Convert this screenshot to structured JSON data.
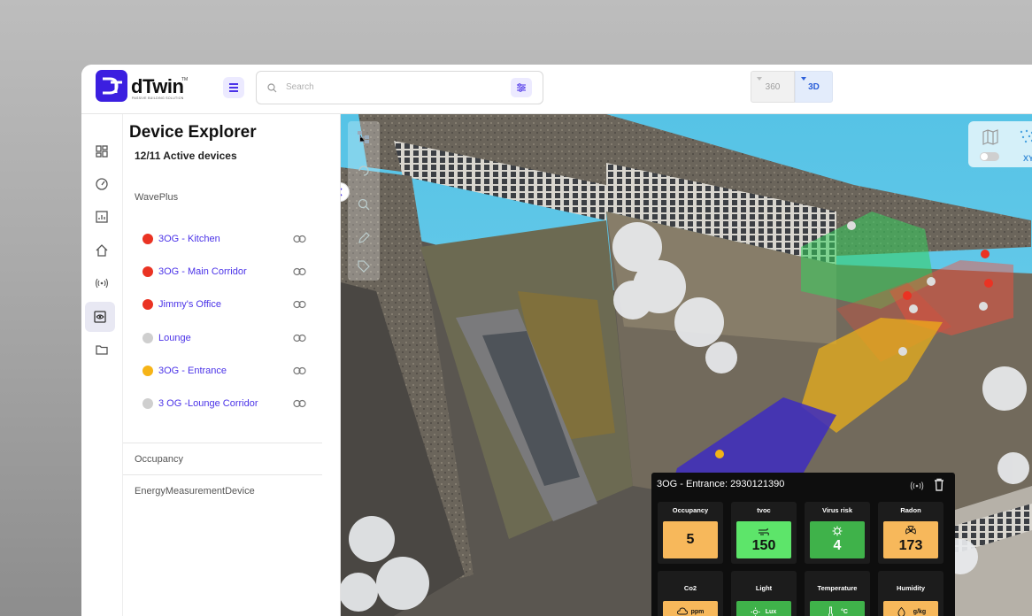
{
  "brand": {
    "name": "dTwin",
    "tagline": "PASSIVE BUILDING SOLUTION",
    "tm": "TM"
  },
  "search": {
    "placeholder": "Search"
  },
  "view_toggle": {
    "option_360": "360",
    "option_3d": "3D",
    "selected": "3D"
  },
  "explorer": {
    "title": "Device Explorer",
    "subtitle": "12/11 Active devices",
    "groups": [
      {
        "name": "WavePlus"
      },
      {
        "name": "Occupancy"
      },
      {
        "name": "EnergyMeasurementDevice"
      }
    ],
    "devices": [
      {
        "label": "3OG - Kitchen",
        "status_color": "#ea3323"
      },
      {
        "label": "3OG - Main Corridor",
        "status_color": "#ea3323"
      },
      {
        "label": "Jimmy's Office",
        "status_color": "#ea3323"
      },
      {
        "label": "Lounge",
        "status_color": "#cfcfcf"
      },
      {
        "label": "3OG - Entrance",
        "status_color": "#f6b417"
      },
      {
        "label": "3 OG -Lounge Corridor",
        "status_color": "#cfcfcf"
      }
    ]
  },
  "viewport": {
    "coord_label": "XY"
  },
  "popup": {
    "title": "3OG - Entrance: 2930121390",
    "tiles": [
      {
        "label": "Occupancy",
        "value": "5",
        "color": "#f7b85b",
        "icon": "none"
      },
      {
        "label": "tvoc",
        "value": "150",
        "color": "#5de56a",
        "icon": "wind-icon"
      },
      {
        "label": "Virus risk",
        "value": "4",
        "color": "#3fb24a",
        "icon": "virus-icon"
      },
      {
        "label": "Radon",
        "value": "173",
        "color": "#f7b85b",
        "icon": "radon-icon"
      }
    ],
    "tiles_row2": [
      {
        "label": "Co2",
        "unit": "ppm",
        "color": "#f7b85b",
        "icon": "cloud-icon"
      },
      {
        "label": "Light",
        "unit": "Lux",
        "color": "#3fb24a",
        "icon": "sun-icon"
      },
      {
        "label": "Temperature",
        "unit": "°C",
        "color": "#3fb24a",
        "icon": "thermometer-icon"
      },
      {
        "label": "Humidity",
        "unit": "g/kg",
        "color": "#f7b85b",
        "icon": "droplet-icon"
      }
    ]
  },
  "colors": {
    "accent": "#4b33e8",
    "brand": "#3b1fe0"
  }
}
